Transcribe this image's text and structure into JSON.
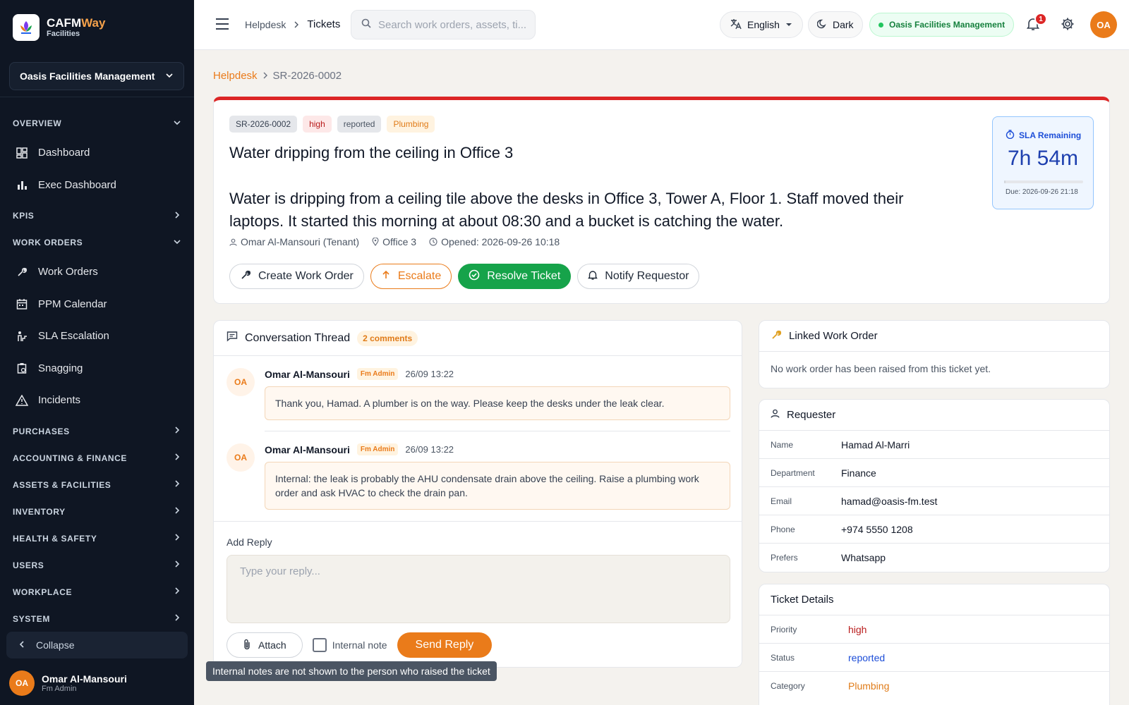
{
  "brand": {
    "name_a": "CAFM",
    "name_b": "Way",
    "sub": "Facilities"
  },
  "org_select": "Oasis Facilities Management",
  "sidebar": {
    "sections": [
      {
        "label": "OVERVIEW",
        "items": [
          {
            "label": "Dashboard",
            "icon": "dashboard-icon"
          },
          {
            "label": "Exec Dashboard",
            "icon": "bar-chart-icon"
          }
        ]
      },
      {
        "label": "KPIS",
        "items": []
      },
      {
        "label": "WORK ORDERS",
        "items": [
          {
            "label": "Work Orders",
            "icon": "wrench-icon"
          },
          {
            "label": "PPM Calendar",
            "icon": "calendar-icon"
          },
          {
            "label": "SLA Escalation",
            "icon": "escalation-icon"
          },
          {
            "label": "Snagging",
            "icon": "clipboard-icon"
          },
          {
            "label": "Incidents",
            "icon": "warning-icon"
          }
        ]
      },
      {
        "label": "PURCHASES"
      },
      {
        "label": "ACCOUNTING & FINANCE"
      },
      {
        "label": "ASSETS & FACILITIES"
      },
      {
        "label": "INVENTORY"
      },
      {
        "label": "HEALTH & SAFETY"
      },
      {
        "label": "USERS"
      },
      {
        "label": "WORKPLACE"
      },
      {
        "label": "SYSTEM"
      }
    ],
    "collapse": "Collapse",
    "user": {
      "initials": "OA",
      "name": "Omar Al-Mansouri",
      "role": "Fm Admin"
    }
  },
  "topbar": {
    "crumb_parent": "Helpdesk",
    "crumb_current": "Tickets",
    "search_placeholder": "Search work orders, assets, ti...",
    "language": "English",
    "theme": "Dark",
    "org": "Oasis Facilities Management",
    "notifications": "1",
    "avatar": "OA"
  },
  "page_crumb": {
    "parent": "Helpdesk",
    "current": "SR-2026-0002"
  },
  "ticket": {
    "id": "SR-2026-0002",
    "priority": "high",
    "status": "reported",
    "category": "Plumbing",
    "title": "Water dripping from the ceiling in Office 3",
    "description": "Water is dripping from a ceiling tile above the desks in Office 3, Tower A, Floor 1. Staff moved their laptops. It started this morning at about 08:30 and a bucket is catching the water.",
    "requester": "Omar Al-Mansouri (Tenant)",
    "location": "Office 3",
    "opened": "Opened: 2026-09-26 10:18",
    "actions": {
      "create": "Create Work Order",
      "escalate": "Escalate",
      "resolve": "Resolve Ticket",
      "notify": "Notify Requestor"
    },
    "sla": {
      "label": "SLA Remaining",
      "time": "7h 54m",
      "due": "Due: 2026-09-26 21:18",
      "progress": 0.02
    }
  },
  "conversation": {
    "title": "Conversation Thread",
    "count": "2 comments",
    "messages": [
      {
        "initials": "OA",
        "author": "Omar Al-Mansouri",
        "role": "Fm Admin",
        "time": "26/09 13:22",
        "text": "Thank you, Hamad. A plumber is on the way. Please keep the desks under the leak clear."
      },
      {
        "initials": "OA",
        "author": "Omar Al-Mansouri",
        "role": "Fm Admin",
        "time": "26/09 13:22",
        "text": "Internal: the leak is probably the AHU condensate drain above the ceiling. Raise a plumbing work order and ask HVAC to check the drain pan."
      }
    ],
    "reply_label": "Add Reply",
    "reply_placeholder": "Type your reply...",
    "attach": "Attach",
    "internal_note": "Internal note",
    "send": "Send Reply",
    "tooltip": "Internal notes are not shown to the person who raised the ticket"
  },
  "linked_wo": {
    "title": "Linked Work Order",
    "empty": "No work order has been raised from this ticket yet."
  },
  "requester": {
    "title": "Requester",
    "rows": [
      {
        "k": "Name",
        "v": "Hamad Al-Marri"
      },
      {
        "k": "Department",
        "v": "Finance"
      },
      {
        "k": "Email",
        "v": "hamad@oasis-fm.test"
      },
      {
        "k": "Phone",
        "v": "+974 5550 1208"
      },
      {
        "k": "Prefers",
        "v": "Whatsapp"
      }
    ]
  },
  "details": {
    "title": "Ticket Details",
    "rows": [
      {
        "k": "Priority",
        "v": "high"
      },
      {
        "k": "Status",
        "v": "reported"
      },
      {
        "k": "Category",
        "v": "Plumbing"
      }
    ]
  },
  "colors": {
    "accent": "#ea7b1a",
    "danger": "#dc2626",
    "success": "#16a34a",
    "sidebar": "#0f1623"
  }
}
